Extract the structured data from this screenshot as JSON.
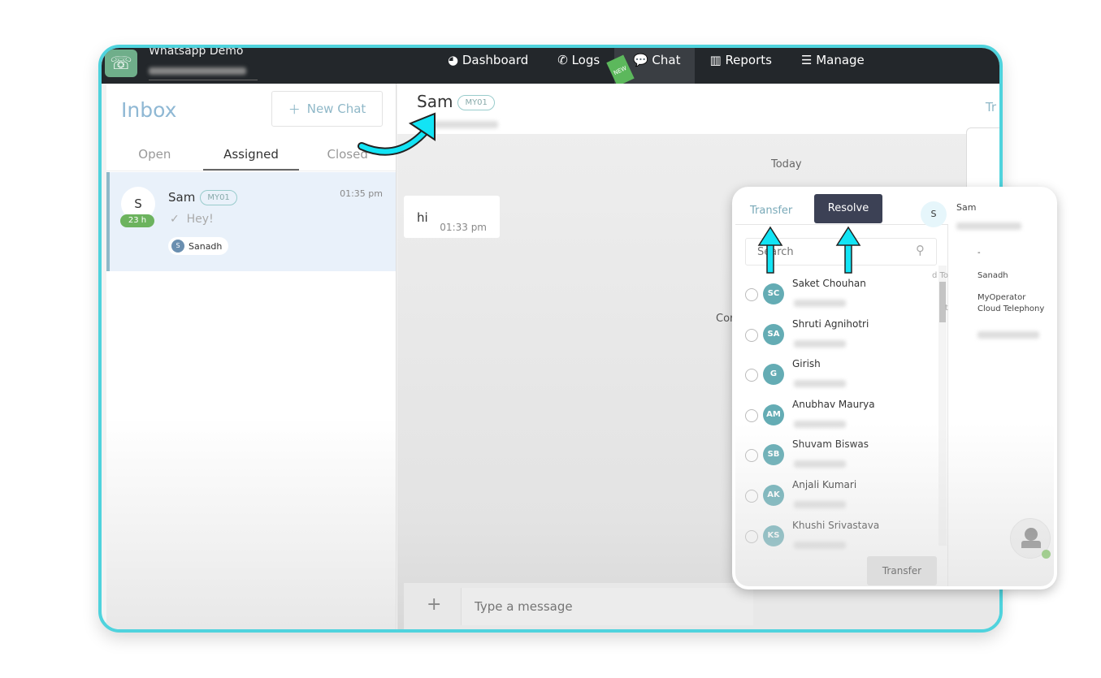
{
  "header": {
    "brand": "Whatsapp Demo",
    "nav": [
      {
        "label": "Dashboard",
        "icon": "pie-chart-icon"
      },
      {
        "label": "Logs",
        "icon": "phone-icon"
      },
      {
        "label": "Chat",
        "icon": "chat-icon",
        "badge": "NEW",
        "active": true
      },
      {
        "label": "Reports",
        "icon": "bar-chart-icon"
      },
      {
        "label": "Manage",
        "icon": "menu-icon"
      }
    ]
  },
  "inbox": {
    "title": "Inbox",
    "new_chat": "New Chat",
    "tabs": [
      "Open",
      "Assigned",
      "Closed"
    ],
    "selected_tab": "Assigned",
    "conversations": [
      {
        "initial": "S",
        "age": "23 h",
        "name": "Sam",
        "tag": "MY01",
        "time": "01:35 pm",
        "last_message": "Hey!",
        "agent_initial": "S",
        "agent": "Sanadh"
      }
    ]
  },
  "chat": {
    "name": "Sam",
    "tag": "MY01",
    "partial_action": "Tr",
    "date_divider": "Today",
    "partial_text": "Cor",
    "messages": [
      {
        "text": "hi",
        "time": "01:33 pm"
      }
    ],
    "compose_placeholder": "Type a message"
  },
  "popup": {
    "transfer_tab": "Transfer",
    "resolve_button": "Resolve",
    "search_placeholder": "Search",
    "transfer_button": "Transfer",
    "agents": [
      {
        "initials": "SC",
        "name": "Saket Chouhan"
      },
      {
        "initials": "SA",
        "name": "Shruti Agnihotri"
      },
      {
        "initials": "G",
        "name": "Girish"
      },
      {
        "initials": "AM",
        "name": "Anubhav Maurya"
      },
      {
        "initials": "SB",
        "name": "Shuvam Biswas"
      },
      {
        "initials": "AK",
        "name": "Anjali Kumari"
      },
      {
        "initials": "KS",
        "name": "Khushi Srivastava"
      }
    ],
    "info": {
      "initial": "S",
      "name": "Sam",
      "dash": "-",
      "assigned_label_partial": "d To",
      "assigned_value": "Sanadh",
      "company_label_partial": "t",
      "company_line1": "MyOperator",
      "company_line2": "Cloud Telephony"
    }
  },
  "colors": {
    "frame": "#4fd3dd",
    "topbar": "#23272b",
    "resolve": "#3c4155",
    "avatar": "#64acb4",
    "age_badge": "#6cb35e",
    "arrow": "#12e4f5"
  }
}
